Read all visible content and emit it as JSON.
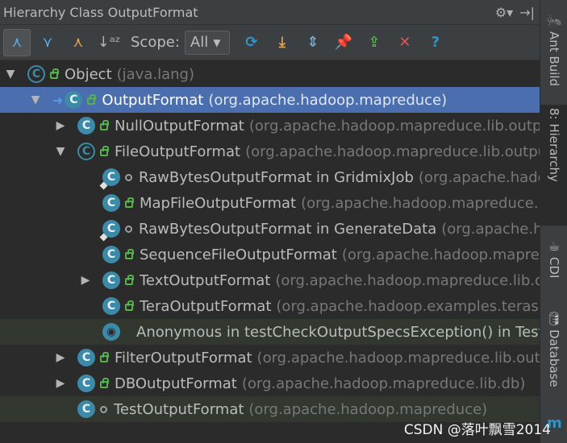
{
  "window": {
    "title": "Hierarchy Class OutputFormat",
    "settings_icon": "gear-icon",
    "hide_icon": "hide-panel-icon"
  },
  "toolbar": {
    "buttons": [
      {
        "name": "class-hierarchy-icon",
        "glyph": "⋏",
        "active": true,
        "color": "#5fa8e8"
      },
      {
        "name": "supertypes-hierarchy-icon",
        "glyph": "⋎",
        "active": false,
        "color": "#5fa8e8"
      },
      {
        "name": "subtypes-hierarchy-icon",
        "glyph": "⋏",
        "active": false,
        "color": "#e0a050"
      },
      {
        "name": "sort-alphabetically-icon",
        "glyph": "↓ᵃᶻ",
        "active": false,
        "color": "#afb1b3"
      }
    ],
    "scope_label": "Scope:",
    "scope_value": "All",
    "action_buttons": [
      {
        "name": "refresh-icon",
        "glyph": "⟳",
        "color": "#3592c4"
      },
      {
        "name": "export-icon",
        "glyph": "⤓",
        "color": "#e0a050"
      },
      {
        "name": "expand-all-icon",
        "glyph": "⇕",
        "color": "#7fa8c8"
      },
      {
        "name": "pin-icon",
        "glyph": "📌",
        "color": "#c070c0"
      },
      {
        "name": "open-in-editor-icon",
        "glyph": "⇪",
        "color": "#54b34b"
      },
      {
        "name": "close-icon",
        "glyph": "✕",
        "color": "#e05555"
      },
      {
        "name": "help-icon",
        "glyph": "?",
        "color": "#3592c4"
      }
    ]
  },
  "tree": [
    {
      "depth": 0,
      "expander": "down",
      "icon": "abstract",
      "vis": "lock",
      "name": "Object",
      "pkg": "(java.lang)",
      "selected": false,
      "hl": false
    },
    {
      "depth": 1,
      "expander": "down",
      "icon": "class",
      "vis": "lock",
      "name": "OutputFormat",
      "pkg": "(org.apache.hadoop.mapreduce)",
      "selected": true,
      "hl": false,
      "arrow": true
    },
    {
      "depth": 2,
      "expander": "right",
      "icon": "class",
      "vis": "lock",
      "name": "NullOutputFormat",
      "pkg": "(org.apache.hadoop.mapreduce.lib.output)",
      "selected": false,
      "hl": false
    },
    {
      "depth": 2,
      "expander": "down",
      "icon": "abstract",
      "vis": "lock",
      "name": "FileOutputFormat",
      "pkg": "(org.apache.hadoop.mapreduce.lib.output)",
      "selected": false,
      "hl": false
    },
    {
      "depth": 3,
      "expander": "",
      "icon": "class-pin",
      "vis": "dot",
      "name": "RawBytesOutputFormat in GridmixJob",
      "pkg": "(org.apache.hadoop.mapred.gridmix)",
      "selected": false,
      "hl": false
    },
    {
      "depth": 3,
      "expander": "",
      "icon": "class",
      "vis": "lock",
      "name": "MapFileOutputFormat",
      "pkg": "(org.apache.hadoop.mapreduce.lib.output)",
      "selected": false,
      "hl": false
    },
    {
      "depth": 3,
      "expander": "",
      "icon": "class-pin",
      "vis": "dot",
      "name": "RawBytesOutputFormat in GenerateData",
      "pkg": "(org.apache.hadoop.mapred.gridmix)",
      "selected": false,
      "hl": false
    },
    {
      "depth": 3,
      "expander": "",
      "icon": "class",
      "vis": "lock",
      "name": "SequenceFileOutputFormat",
      "pkg": "(org.apache.hadoop.mapreduce.lib.output)",
      "selected": false,
      "hl": false
    },
    {
      "depth": 3,
      "expander": "right",
      "icon": "class",
      "vis": "lock",
      "name": "TextOutputFormat",
      "pkg": "(org.apache.hadoop.mapreduce.lib.output)",
      "selected": false,
      "hl": false
    },
    {
      "depth": 3,
      "expander": "",
      "icon": "class",
      "vis": "lock",
      "name": "TeraOutputFormat",
      "pkg": "(org.apache.hadoop.examples.terasort)",
      "selected": false,
      "hl": false
    },
    {
      "depth": 3,
      "expander": "",
      "icon": "anon",
      "vis": "",
      "name": "Anonymous in testCheckOutputSpecsException() in TestFileOutputFormat",
      "pkg": "",
      "selected": false,
      "hl": true
    },
    {
      "depth": 2,
      "expander": "right",
      "icon": "class",
      "vis": "lock",
      "name": "FilterOutputFormat",
      "pkg": "(org.apache.hadoop.mapreduce.lib.output)",
      "selected": false,
      "hl": false
    },
    {
      "depth": 2,
      "expander": "right",
      "icon": "class",
      "vis": "lock",
      "name": "DBOutputFormat",
      "pkg": "(org.apache.hadoop.mapreduce.lib.db)",
      "selected": false,
      "hl": false
    },
    {
      "depth": 2,
      "expander": "",
      "icon": "class",
      "vis": "dot",
      "name": "TestOutputFormat",
      "pkg": "(org.apache.hadoop.mapreduce)",
      "selected": false,
      "hl": true
    }
  ],
  "sidebar": {
    "tabs": [
      {
        "label": "Ant Build",
        "icon": "ant-icon",
        "glyph": "🐜",
        "active": false
      },
      {
        "label": "8: Hierarchy",
        "icon": "hierarchy-icon",
        "glyph": "",
        "active": true
      },
      {
        "label": "CDI",
        "icon": "cdi-icon",
        "glyph": "☕",
        "active": false
      },
      {
        "label": "Database",
        "icon": "database-icon",
        "glyph": "🛢",
        "active": false
      }
    ],
    "bottom_label": "m"
  },
  "watermark": "CSDN @落叶飘雪2014",
  "colors": {
    "selection": "#4b6eaf",
    "class_icon": "#3d8aa8",
    "public_lock": "#54b34b",
    "background": "#2b2b2b",
    "toolbar": "#3c3f41"
  }
}
